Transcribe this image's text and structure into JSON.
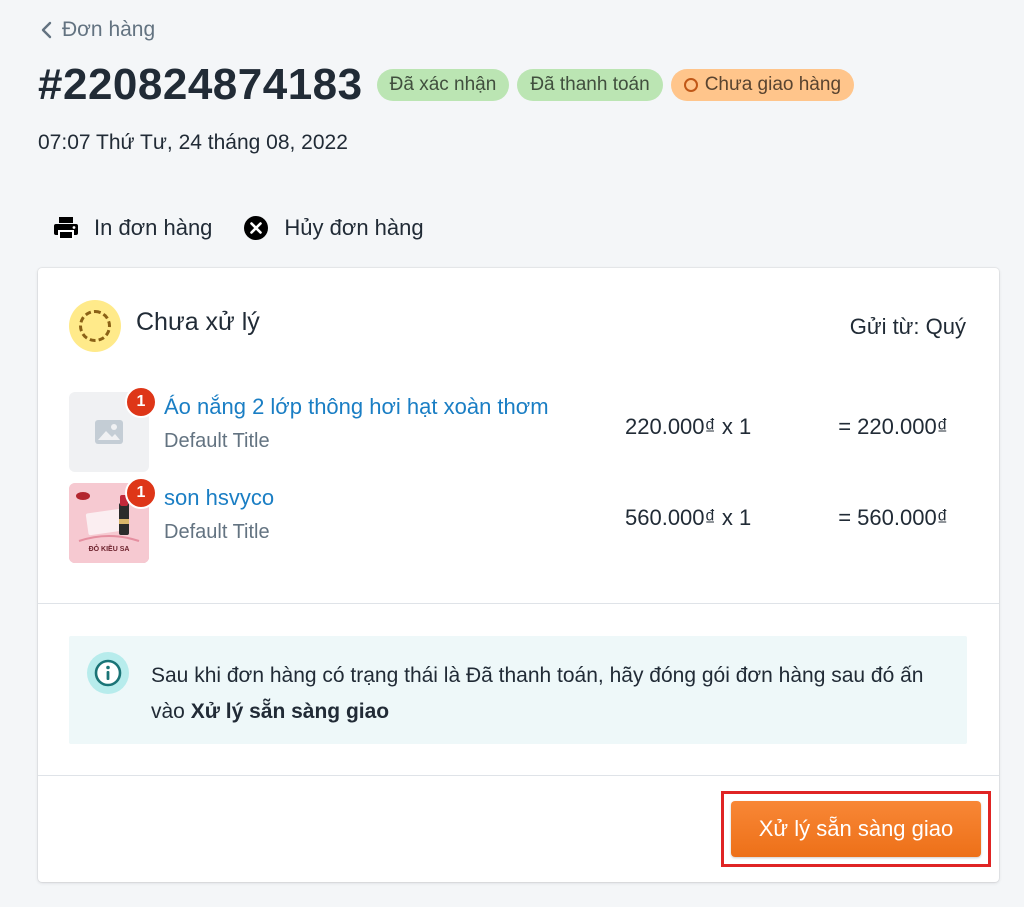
{
  "nav": {
    "back_label": "Đơn hàng"
  },
  "order": {
    "id": "#220824874183",
    "date": "07:07 Thứ Tư, 24 tháng 08, 2022",
    "badges": [
      {
        "label": "Đã xác nhận",
        "color": "#bbe5b3"
      },
      {
        "label": "Đã thanh toán",
        "color": "#bbe5b3"
      },
      {
        "label": "Chưa giao hàng",
        "color": "#ffc58b"
      }
    ]
  },
  "actions": {
    "print_label": "In đơn hàng",
    "cancel_label": "Hủy đơn hàng"
  },
  "fulfillment": {
    "status_title": "Chưa xử lý",
    "send_from": "Gửi từ: Quý",
    "items": [
      {
        "qty_badge": "1",
        "name": "Áo nắng 2 lớp thông hơi hạt xoàn thơm",
        "variant": "Default Title",
        "price_qty": "220.000₫ x 1",
        "total": "=  220.000₫",
        "thumb_icon": "image-placeholder-icon"
      },
      {
        "qty_badge": "1",
        "name": "son hsvyco",
        "variant": "Default Title",
        "price_qty": "560.000₫ x 1",
        "total": "=  560.000₫",
        "thumb_text": "ĐỎ KIỀU SA",
        "thumb_icon": "lipstick-product-image"
      }
    ],
    "info": {
      "text_before": "Sau khi đơn hàng có trạng thái là Đã thanh toán, hãy đóng gói đơn hàng sau đó ấn vào ",
      "text_bold": "Xử lý sẵn sàng giao"
    },
    "primary_button": "Xử lý sẵn sàng giao"
  },
  "colors": {
    "accent_orange": "#f5822d",
    "link_blue": "#1a7ec4",
    "badge_red": "#de3618",
    "highlight_red": "#e02424"
  }
}
